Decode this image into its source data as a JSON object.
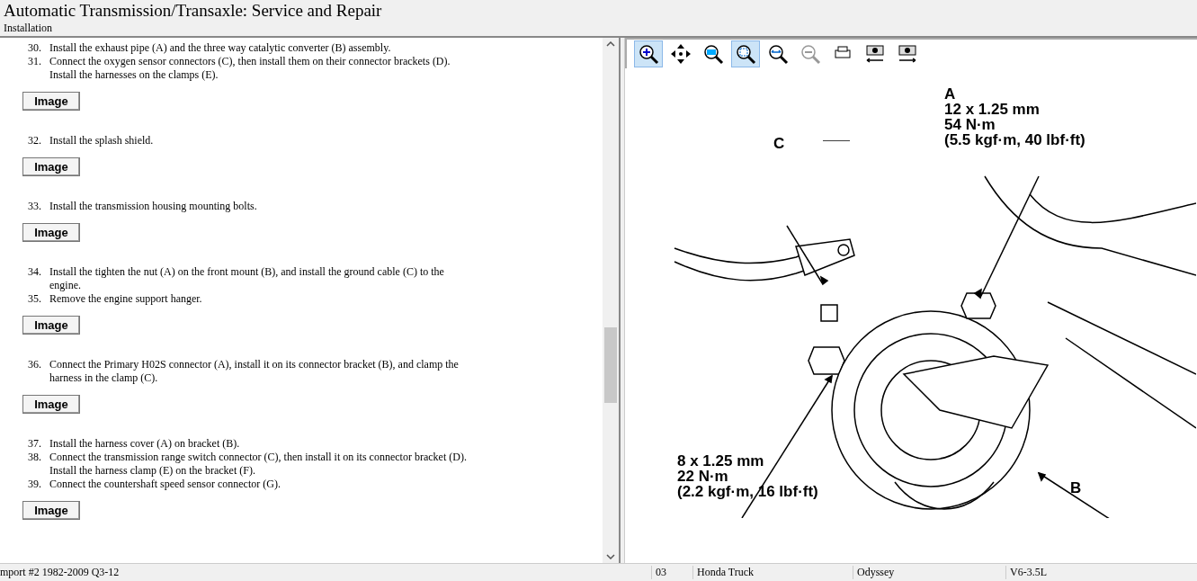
{
  "header": {
    "title": "Automatic Transmission/Transaxle:  Service and Repair",
    "subtitle": "Installation"
  },
  "steps": [
    {
      "items": [
        {
          "num": "30.",
          "text": "Install the exhaust pipe (A) and the three way catalytic converter (B) assembly."
        },
        {
          "num": "31.",
          "text": "Connect the oxygen sensor connectors (C), then install them on their connector brackets (D). Install the harnesses on the clamps (E)."
        }
      ],
      "button": "Image",
      "selected": false
    },
    {
      "items": [
        {
          "num": "32.",
          "text": "Install the splash shield."
        }
      ],
      "button": "Image",
      "selected": false
    },
    {
      "items": [
        {
          "num": "33.",
          "text": "Install the transmission housing mounting bolts."
        }
      ],
      "button": "Image",
      "selected": false
    },
    {
      "items": [
        {
          "num": "34.",
          "text": "Install the tighten the nut (A) on the front mount (B), and install the ground cable (C) to the engine."
        },
        {
          "num": "35.",
          "text": "Remove the engine support hanger."
        }
      ],
      "button": "Image",
      "selected": false
    },
    {
      "items": [
        {
          "num": "36.",
          "text": "Connect the Primary H02S connector (A), install it on its connector bracket (B), and clamp the harness in the clamp (C)."
        }
      ],
      "button": "Image",
      "selected": false
    },
    {
      "items": [
        {
          "num": "37.",
          "text": "Install the harness cover (A) on bracket (B)."
        },
        {
          "num": "38.",
          "text": "Connect the transmission range switch connector (C), then install it on its connector bracket (D). Install the harness clamp (E) on the bracket (F)."
        },
        {
          "num": "39.",
          "text": "Connect the countershaft speed sensor connector (G)."
        }
      ],
      "button": "Image",
      "selected": false
    }
  ],
  "toolbar": [
    {
      "kind": "zoom-in",
      "selected": true,
      "disabled": false
    },
    {
      "kind": "pan",
      "selected": false,
      "disabled": false
    },
    {
      "kind": "actual-size",
      "selected": false,
      "disabled": false
    },
    {
      "kind": "fit",
      "selected": true,
      "disabled": false
    },
    {
      "kind": "fit-width",
      "selected": false,
      "disabled": false
    },
    {
      "kind": "zoom-out",
      "selected": false,
      "disabled": true
    },
    {
      "kind": "print",
      "selected": false,
      "disabled": false
    },
    {
      "kind": "prev-image",
      "selected": false,
      "disabled": false
    },
    {
      "kind": "next-image",
      "selected": false,
      "disabled": false
    }
  ],
  "diagram": {
    "label_a": [
      "A",
      "12 x 1.25 mm",
      "54 N·m",
      "(5.5 kgf·m, 40 lbf·ft)"
    ],
    "label_c": "C",
    "label_bolt": [
      "8 x 1.25 mm",
      "22 N·m",
      "(2.2 kgf·m, 16 lbf·ft)"
    ],
    "label_b": "B"
  },
  "status_bar": [
    "mport #2 1982-2009 Q3-12",
    "03",
    "Honda Truck",
    "Odyssey",
    "V6-3.5L"
  ]
}
